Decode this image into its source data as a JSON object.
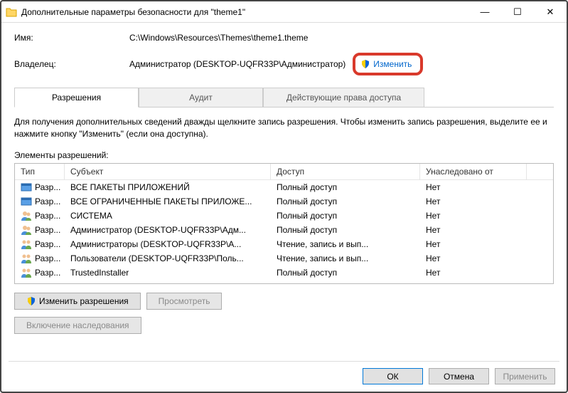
{
  "window": {
    "title": "Дополнительные параметры безопасности для \"theme1\""
  },
  "info": {
    "name_label": "Имя:",
    "name_value": "C:\\Windows\\Resources\\Themes\\theme1.theme",
    "owner_label": "Владелец:",
    "owner_value": "Администратор (DESKTOP-UQFR33P\\Администратор)",
    "change_label": "Изменить"
  },
  "tabs": {
    "t1": "Разрешения",
    "t2": "Аудит",
    "t3": "Действующие права доступа"
  },
  "desc": "Для получения дополнительных сведений дважды щелкните запись разрешения. Чтобы изменить запись разрешения, выделите ее и нажмите кнопку \"Изменить\" (если она доступна).",
  "section_label": "Элементы разрешений:",
  "columns": {
    "type": "Тип",
    "subject": "Субъект",
    "access": "Доступ",
    "inherited": "Унаследовано от"
  },
  "rows": [
    {
      "icon": "pkg",
      "type": "Разр...",
      "subject": "ВСЕ ПАКЕТЫ ПРИЛОЖЕНИЙ",
      "access": "Полный доступ",
      "inherited": "Нет"
    },
    {
      "icon": "pkg",
      "type": "Разр...",
      "subject": "ВСЕ ОГРАНИЧЕННЫЕ ПАКЕТЫ ПРИЛОЖЕ...",
      "access": "Полный доступ",
      "inherited": "Нет"
    },
    {
      "icon": "user",
      "type": "Разр...",
      "subject": "СИСТЕМА",
      "access": "Полный доступ",
      "inherited": "Нет"
    },
    {
      "icon": "user",
      "type": "Разр...",
      "subject": "Администратор (DESKTOP-UQFR33P\\Адм...",
      "access": "Полный доступ",
      "inherited": "Нет"
    },
    {
      "icon": "grp",
      "type": "Разр...",
      "subject": "Администраторы (DESKTOP-UQFR33P\\А...",
      "access": "Чтение, запись и вып...",
      "inherited": "Нет"
    },
    {
      "icon": "grp",
      "type": "Разр...",
      "subject": "Пользователи (DESKTOP-UQFR33P\\Поль...",
      "access": "Чтение, запись и вып...",
      "inherited": "Нет"
    },
    {
      "icon": "grp",
      "type": "Разр...",
      "subject": "TrustedInstaller",
      "access": "Полный доступ",
      "inherited": "Нет"
    }
  ],
  "buttons": {
    "edit_perm": "Изменить разрешения",
    "view": "Просмотреть",
    "enable_inh": "Включение наследования",
    "ok": "ОК",
    "cancel": "Отмена",
    "apply": "Применить"
  }
}
